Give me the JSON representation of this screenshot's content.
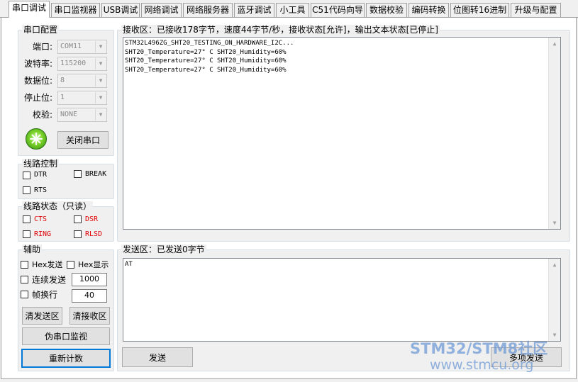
{
  "tabs": [
    {
      "label": "串口调试",
      "active": true
    },
    {
      "label": "串口监视器"
    },
    {
      "label": "USB调试"
    },
    {
      "label": "网络调试"
    },
    {
      "label": "网络服务器"
    },
    {
      "label": "蓝牙调试"
    },
    {
      "label": "小工具"
    },
    {
      "label": "C51代码向导"
    },
    {
      "label": "数据校验"
    },
    {
      "label": "编码转换"
    },
    {
      "label": "位图转16进制"
    },
    {
      "label": "升级与配置"
    }
  ],
  "serial_config": {
    "title": "串口配置",
    "port_label": "端口:",
    "port_value": "COM11",
    "baud_label": "波特率:",
    "baud_value": "115200",
    "databits_label": "数据位:",
    "databits_value": "8",
    "stopbits_label": "停止位:",
    "stopbits_value": "1",
    "parity_label": "校验:",
    "parity_value": "NONE",
    "close_button": "关闭串口"
  },
  "line_control": {
    "title": "线路控制",
    "dtr": "DTR",
    "break": "BREAK",
    "rts": "RTS"
  },
  "line_status": {
    "title": "线路状态（只读）",
    "cts": "CTS",
    "dsr": "DSR",
    "ring": "RING",
    "rlsd": "RLSD"
  },
  "aux": {
    "title": "辅助",
    "hex_send": "Hex发送",
    "hex_display": "Hex显示",
    "continuous_send": "连续发送",
    "continuous_interval": "1000",
    "frame_newline": "帧换行",
    "frame_value": "40",
    "clear_send": "清发送区",
    "clear_recv": "清接收区",
    "pseudo_monitor": "伪串口监视",
    "recount": "重新计数"
  },
  "receive": {
    "header": "接收区：已接收178字节，速度44字节/秒，接收状态[允许]，输出文本状态[已停止]",
    "lines": [
      "STM32L496ZG_SHT20_TESTING_ON_HARDWARE_I2C...",
      "SHT20_Temperature=27° C SHT20_Humidity=60%",
      "SHT20_Temperature=27° C SHT20_Humidity=60%",
      "SHT20_Temperature=27° C SHT20_Humidity=60%"
    ]
  },
  "send": {
    "header": "发送区：已发送0字节",
    "text": "AT",
    "send_button": "发送",
    "multi_send_button": "多项发送"
  },
  "watermark": {
    "line1": "STM32/STM8社区",
    "line2": "www.stmcu.org"
  },
  "colors": {
    "accent": "#0078d7",
    "status_red": "#e00000",
    "watermark": "#6f9ad6"
  }
}
